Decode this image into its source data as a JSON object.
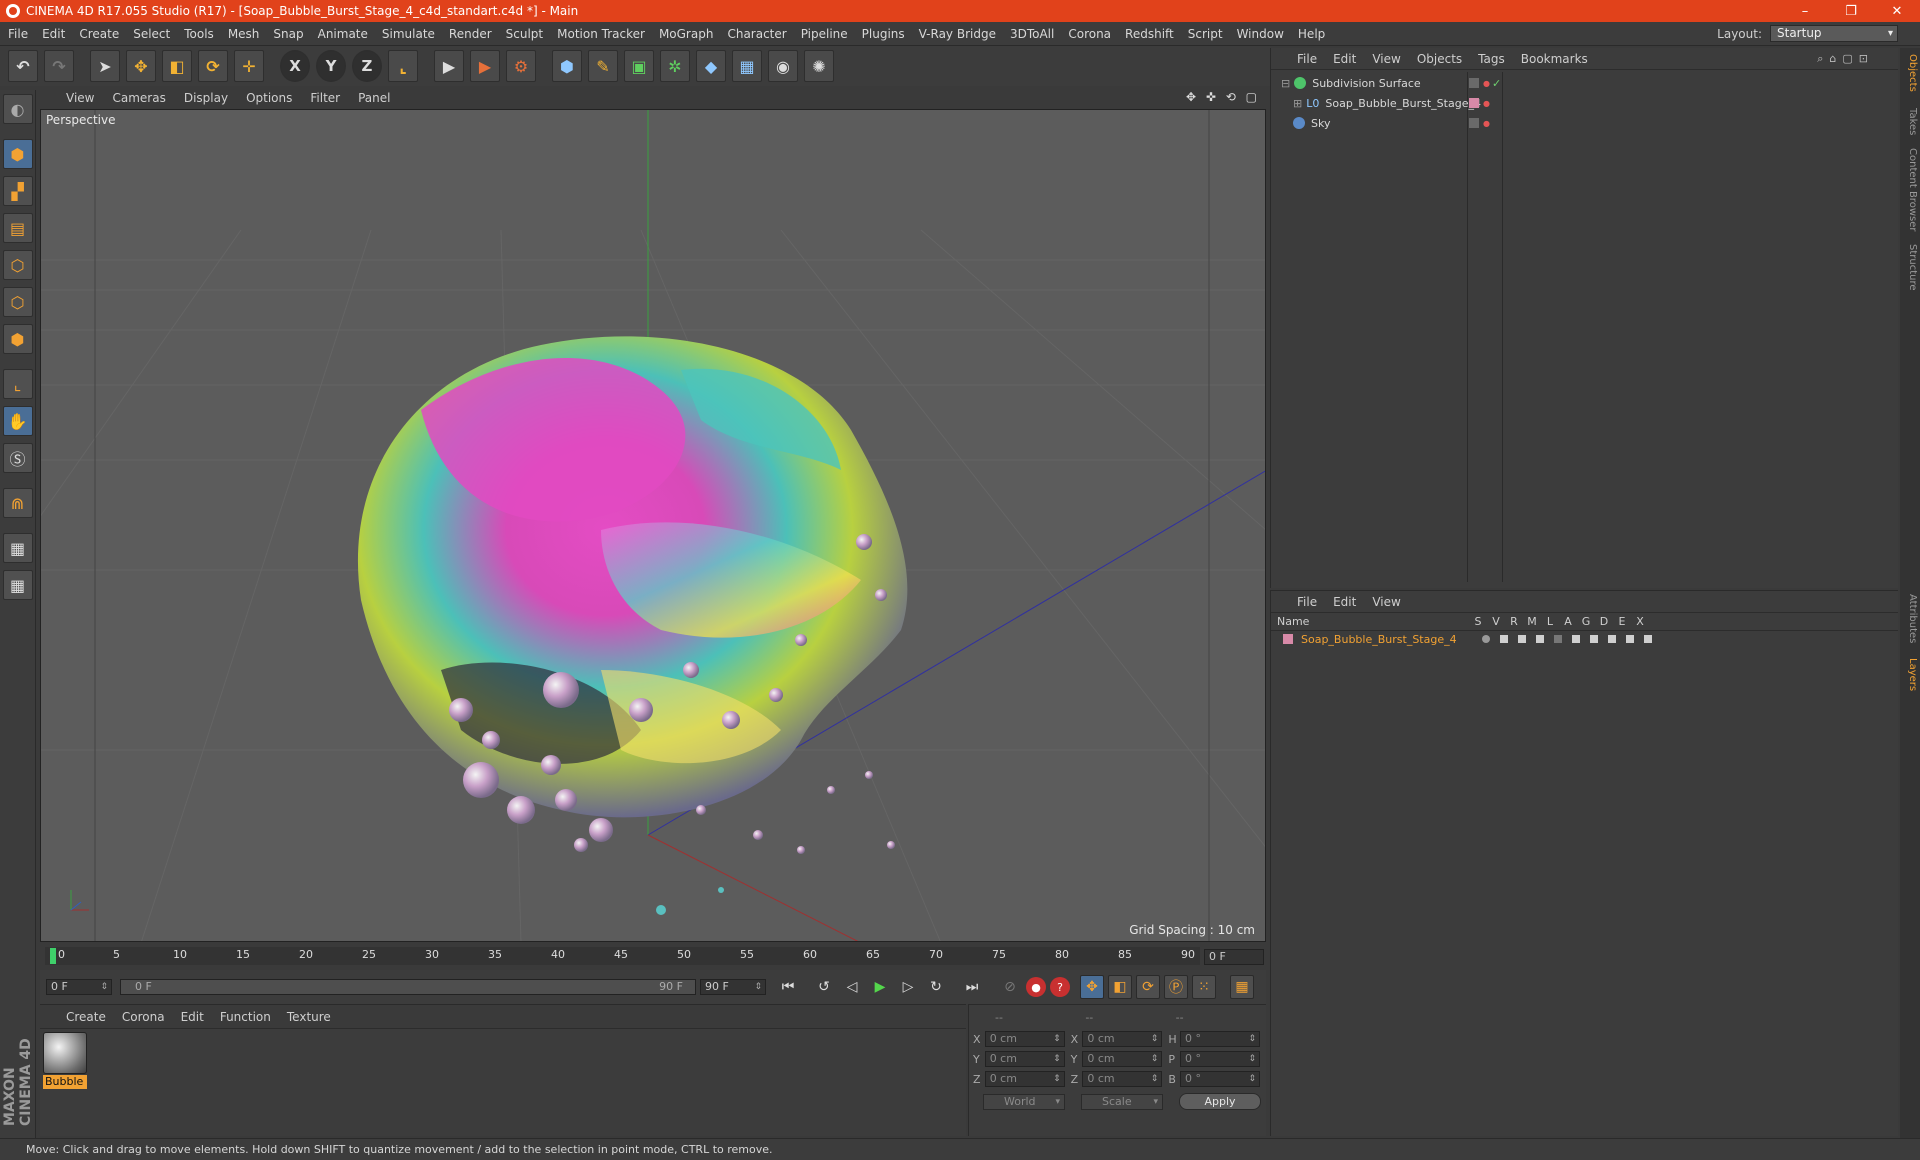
{
  "window": {
    "title": "CINEMA 4D R17.055 Studio (R17) - [Soap_Bubble_Burst_Stage_4_c4d_standart.c4d *] - Main",
    "minimize": "–",
    "restore": "❐",
    "close": "✕"
  },
  "menubar": {
    "items": [
      "File",
      "Edit",
      "Create",
      "Select",
      "Tools",
      "Mesh",
      "Snap",
      "Animate",
      "Simulate",
      "Render",
      "Sculpt",
      "Motion Tracker",
      "MoGraph",
      "Character",
      "Pipeline",
      "Plugins",
      "V-Ray Bridge",
      "3DToAll",
      "Corona",
      "Redshift",
      "Script",
      "Window",
      "Help"
    ],
    "layout_label": "Layout:",
    "layout_value": "Startup"
  },
  "viewport": {
    "menu": [
      "View",
      "Cameras",
      "Display",
      "Options",
      "Filter",
      "Panel"
    ],
    "label": "Perspective",
    "grid_spacing": "Grid Spacing : 10 cm",
    "nav_icons": "✥ ✜ ⟲ ▢"
  },
  "timeline": {
    "ticks": [
      "0",
      "5",
      "10",
      "15",
      "20",
      "25",
      "30",
      "35",
      "40",
      "45",
      "50",
      "55",
      "60",
      "65",
      "70",
      "75",
      "80",
      "85",
      "90"
    ],
    "current_frame_display": "0 F",
    "start_field": "0 F",
    "range_start": "0 F",
    "range_end": "90 F",
    "end_field": "90 F"
  },
  "material_panel": {
    "menu": [
      "Create",
      "Corona",
      "Edit",
      "Function",
      "Texture"
    ],
    "material_name": "Bubble"
  },
  "coordinates": {
    "headers": [
      "--",
      "--",
      "--"
    ],
    "rows": [
      {
        "a1": "X",
        "v1": "0 cm",
        "a2": "X",
        "v2": "0 cm",
        "a3": "H",
        "v3": "0 °"
      },
      {
        "a1": "Y",
        "v1": "0 cm",
        "a2": "Y",
        "v2": "0 cm",
        "a3": "P",
        "v3": "0 °"
      },
      {
        "a1": "Z",
        "v1": "0 cm",
        "a2": "Z",
        "v2": "0 cm",
        "a3": "B",
        "v3": "0 °"
      }
    ],
    "space": "World",
    "mode": "Scale",
    "apply": "Apply"
  },
  "object_manager": {
    "menu": [
      "File",
      "Edit",
      "View",
      "Objects",
      "Tags",
      "Bookmarks"
    ],
    "objects": [
      {
        "name": "Subdivision Surface"
      },
      {
        "name": "Soap_Bubble_Burst_Stage_4"
      },
      {
        "name": "Sky"
      }
    ]
  },
  "layer_manager": {
    "menu": [
      "File",
      "Edit",
      "View"
    ],
    "columns": [
      "Name",
      "S",
      "V",
      "R",
      "M",
      "L",
      "A",
      "G",
      "D",
      "E",
      "X"
    ],
    "layers": [
      {
        "name": "Soap_Bubble_Burst_Stage_4"
      }
    ]
  },
  "side_tabs": [
    "Objects",
    "Takes",
    "Content Browser",
    "Structure",
    "Attributes",
    "Layers"
  ],
  "status": "Move: Click and drag to move elements. Hold down SHIFT to quantize movement / add to the selection in point mode, CTRL to remove.",
  "brand": "MAXON CINEMA 4D",
  "colors": {
    "titlebar": "#e1421b",
    "accent": "#f2a233",
    "viewport_bg": "#5c5c5c"
  }
}
